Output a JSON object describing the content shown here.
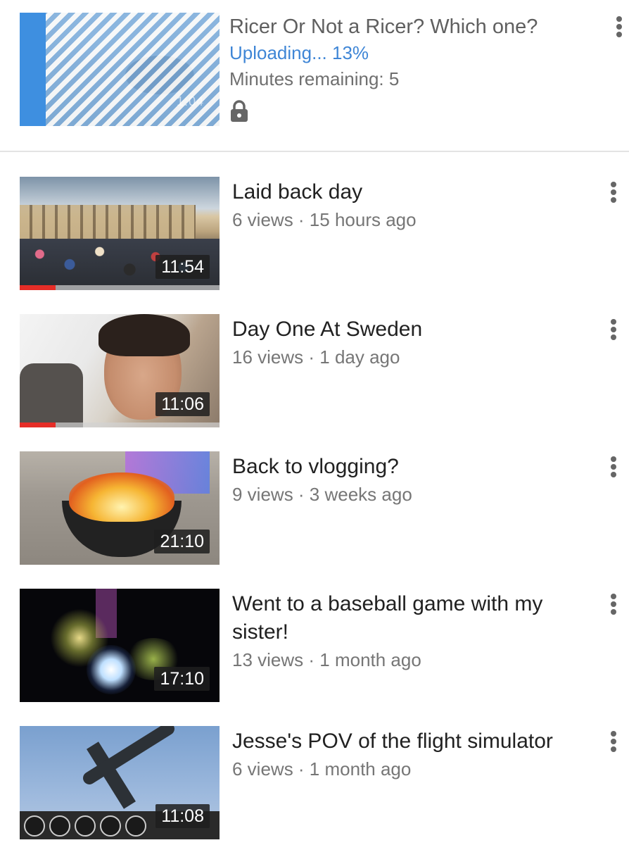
{
  "upload": {
    "title": "Ricer Or Not a Ricer? Which one?",
    "status": "Uploading... 13%",
    "progress_percent": 13,
    "remaining": "Minutes remaining: 5",
    "privacy_icon": "lock-icon",
    "thumb_time_ghost": "1:04"
  },
  "videos": [
    {
      "title": "Laid back day",
      "meta": "6 views · 15 hours ago",
      "duration": "11:54",
      "watched_percent": 18
    },
    {
      "title": "Day One At Sweden",
      "meta": "16 views · 1 day ago",
      "duration": "11:06",
      "watched_percent": 18
    },
    {
      "title": "Back to vlogging?",
      "meta": "9 views · 3 weeks ago",
      "duration": "21:10",
      "watched_percent": 0
    },
    {
      "title": "Went to a baseball game with my sister!",
      "meta": "13 views · 1 month ago",
      "duration": "17:10",
      "watched_percent": 0
    },
    {
      "title": "Jesse's POV of the flight simulator",
      "meta": "6 views · 1 month ago",
      "duration": "11:08",
      "watched_percent": 0
    }
  ],
  "colors": {
    "accent_blue": "#3f86d6",
    "progress_red": "#e52d27"
  }
}
